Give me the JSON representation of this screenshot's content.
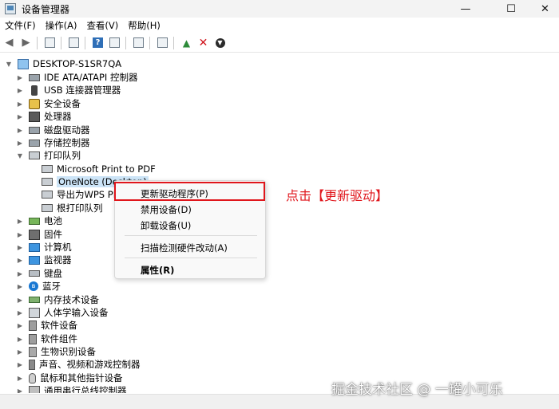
{
  "window": {
    "title": "设备管理器",
    "minimize": "—",
    "maximize": "☐",
    "close": "✕"
  },
  "menubar": [
    "文件(F)",
    "操作(A)",
    "查看(V)",
    "帮助(H)"
  ],
  "toolbar": {
    "help_label": "?"
  },
  "tree": {
    "root": "DESKTOP-S1SR7QA",
    "categories": [
      "IDE ATA/ATAPI 控制器",
      "USB 连接器管理器",
      "安全设备",
      "处理器",
      "磁盘驱动器",
      "存储控制器",
      "打印队列",
      "电池",
      "固件",
      "计算机",
      "监视器",
      "键盘",
      "蓝牙",
      "内存技术设备",
      "人体学输入设备",
      "软件设备",
      "软件组件",
      "生物识别设备",
      "声音、视频和游戏控制器",
      "鼠标和其他指针设备",
      "通用串行总线控制器"
    ],
    "print_queue_children": [
      "Microsoft Print to PDF",
      "OneNote (Desktop)",
      "导出为WPS PDF",
      "根打印队列"
    ]
  },
  "context_menu": {
    "items": [
      "更新驱动程序(P)",
      "禁用设备(D)",
      "卸载设备(U)",
      "扫描检测硬件改动(A)",
      "属性(R)"
    ]
  },
  "annotation": "点击【更新驱动】",
  "watermark": "掘金技术社区 @ 一罐小可乐",
  "colors": {
    "annotation": "#e0161c",
    "selection": "#cce4f7"
  }
}
